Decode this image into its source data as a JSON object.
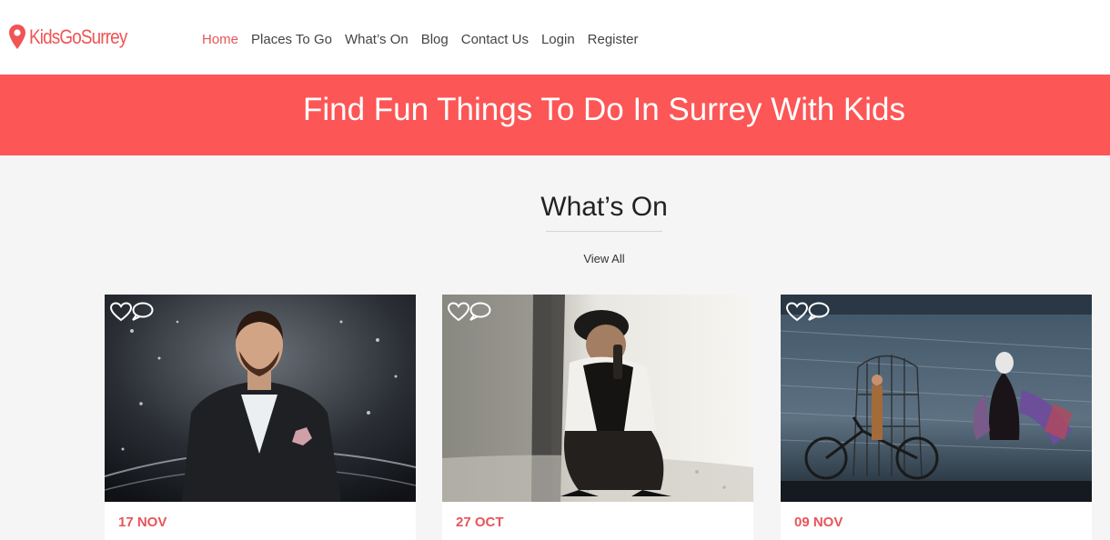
{
  "brand": {
    "name": "KidsGoSurrey",
    "color": "#f05454"
  },
  "nav": [
    {
      "label": "Home",
      "active": true
    },
    {
      "label": "Places To Go"
    },
    {
      "label": "What’s On"
    },
    {
      "label": "Blog"
    },
    {
      "label": "Contact Us"
    },
    {
      "label": "Login"
    },
    {
      "label": "Register"
    }
  ],
  "banner": {
    "title": "Find Fun Things To Do In Surrey With Kids",
    "color": "#fd5656"
  },
  "section": {
    "title": "What’s On",
    "view_all": "View All"
  },
  "cards": [
    {
      "date": "17 NOV",
      "image": "magician-in-suit",
      "icons": [
        "heart-icon",
        "comment-icon"
      ]
    },
    {
      "date": "27 OCT",
      "image": "man-crouching-by-wall",
      "icons": [
        "heart-icon",
        "comment-icon"
      ]
    },
    {
      "date": "09 NOV",
      "image": "stage-show-with-bicycles",
      "icons": [
        "heart-icon",
        "comment-icon"
      ]
    }
  ]
}
